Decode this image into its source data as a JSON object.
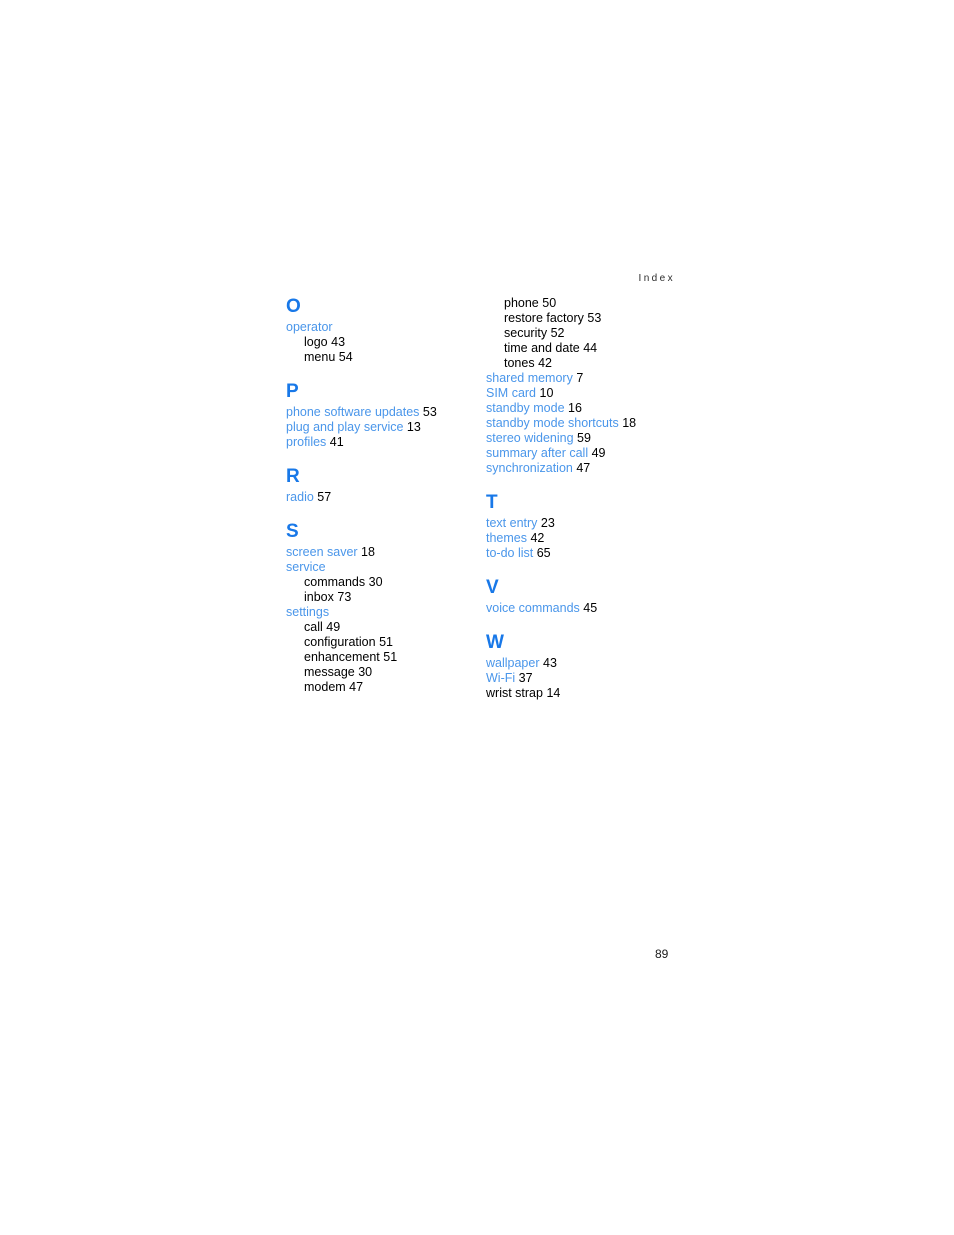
{
  "page": {
    "running_header": "Index",
    "folio": "89",
    "colors": {
      "section_letter": "#1878e8",
      "term_link": "#4a96ea",
      "body_text": "#000000",
      "header_text": "#2b2b2b",
      "background": "#ffffff"
    }
  },
  "columns": [
    {
      "name": "left-column",
      "sections": [
        {
          "letter": "O",
          "entries": [
            {
              "term": "operator",
              "page": "",
              "level": 0,
              "link": true
            },
            {
              "term": "logo",
              "page": "43",
              "level": 1,
              "link": false
            },
            {
              "term": "menu",
              "page": "54",
              "level": 1,
              "link": false
            }
          ]
        },
        {
          "letter": "P",
          "entries": [
            {
              "term": "phone software updates",
              "page": "53",
              "level": 0,
              "link": true
            },
            {
              "term": "plug and play service",
              "page": "13",
              "level": 0,
              "link": true
            },
            {
              "term": "profiles",
              "page": "41",
              "level": 0,
              "link": true
            }
          ]
        },
        {
          "letter": "R",
          "entries": [
            {
              "term": "radio",
              "page": "57",
              "level": 0,
              "link": true
            }
          ]
        },
        {
          "letter": "S",
          "entries": [
            {
              "term": "screen saver",
              "page": "18",
              "level": 0,
              "link": true
            },
            {
              "term": "service",
              "page": "",
              "level": 0,
              "link": true
            },
            {
              "term": "commands",
              "page": "30",
              "level": 1,
              "link": false
            },
            {
              "term": "inbox",
              "page": "73",
              "level": 1,
              "link": false
            },
            {
              "term": "settings",
              "page": "",
              "level": 0,
              "link": true
            },
            {
              "term": "call",
              "page": "49",
              "level": 1,
              "link": false
            },
            {
              "term": "configuration",
              "page": "51",
              "level": 1,
              "link": false
            },
            {
              "term": "enhancement",
              "page": "51",
              "level": 1,
              "link": false
            },
            {
              "term": "message",
              "page": "30",
              "level": 1,
              "link": false
            },
            {
              "term": "modem",
              "page": "47",
              "level": 1,
              "link": false
            }
          ]
        }
      ]
    },
    {
      "name": "right-column",
      "sections": [
        {
          "letter": "",
          "continued": true,
          "entries": [
            {
              "term": "phone",
              "page": "50",
              "level": 1,
              "link": false
            },
            {
              "term": "restore factory",
              "page": "53",
              "level": 1,
              "link": false
            },
            {
              "term": "security",
              "page": "52",
              "level": 1,
              "link": false
            },
            {
              "term": "time and date",
              "page": "44",
              "level": 1,
              "link": false
            },
            {
              "term": "tones",
              "page": "42",
              "level": 1,
              "link": false
            },
            {
              "term": "shared memory",
              "page": "7",
              "level": 0,
              "link": true
            },
            {
              "term": "SIM card",
              "page": "10",
              "level": 0,
              "link": true
            },
            {
              "term": "standby mode",
              "page": "16",
              "level": 0,
              "link": true
            },
            {
              "term": "standby mode shortcuts",
              "page": "18",
              "level": 0,
              "link": true
            },
            {
              "term": "stereo widening",
              "page": "59",
              "level": 0,
              "link": true
            },
            {
              "term": "summary after call",
              "page": "49",
              "level": 0,
              "link": true
            },
            {
              "term": "synchronization",
              "page": "47",
              "level": 0,
              "link": true
            }
          ]
        },
        {
          "letter": "T",
          "entries": [
            {
              "term": "text entry",
              "page": "23",
              "level": 0,
              "link": true
            },
            {
              "term": "themes",
              "page": "42",
              "level": 0,
              "link": true
            },
            {
              "term": "to-do list",
              "page": "65",
              "level": 0,
              "link": true
            }
          ]
        },
        {
          "letter": "V",
          "entries": [
            {
              "term": "voice commands",
              "page": "45",
              "level": 0,
              "link": true
            }
          ]
        },
        {
          "letter": "W",
          "entries": [
            {
              "term": "wallpaper",
              "page": "43",
              "level": 0,
              "link": true
            },
            {
              "term": "Wi-Fi",
              "page": "37",
              "level": 0,
              "link": true
            },
            {
              "term": "wrist strap",
              "page": "14",
              "level": 0,
              "link": false
            }
          ]
        }
      ]
    }
  ]
}
